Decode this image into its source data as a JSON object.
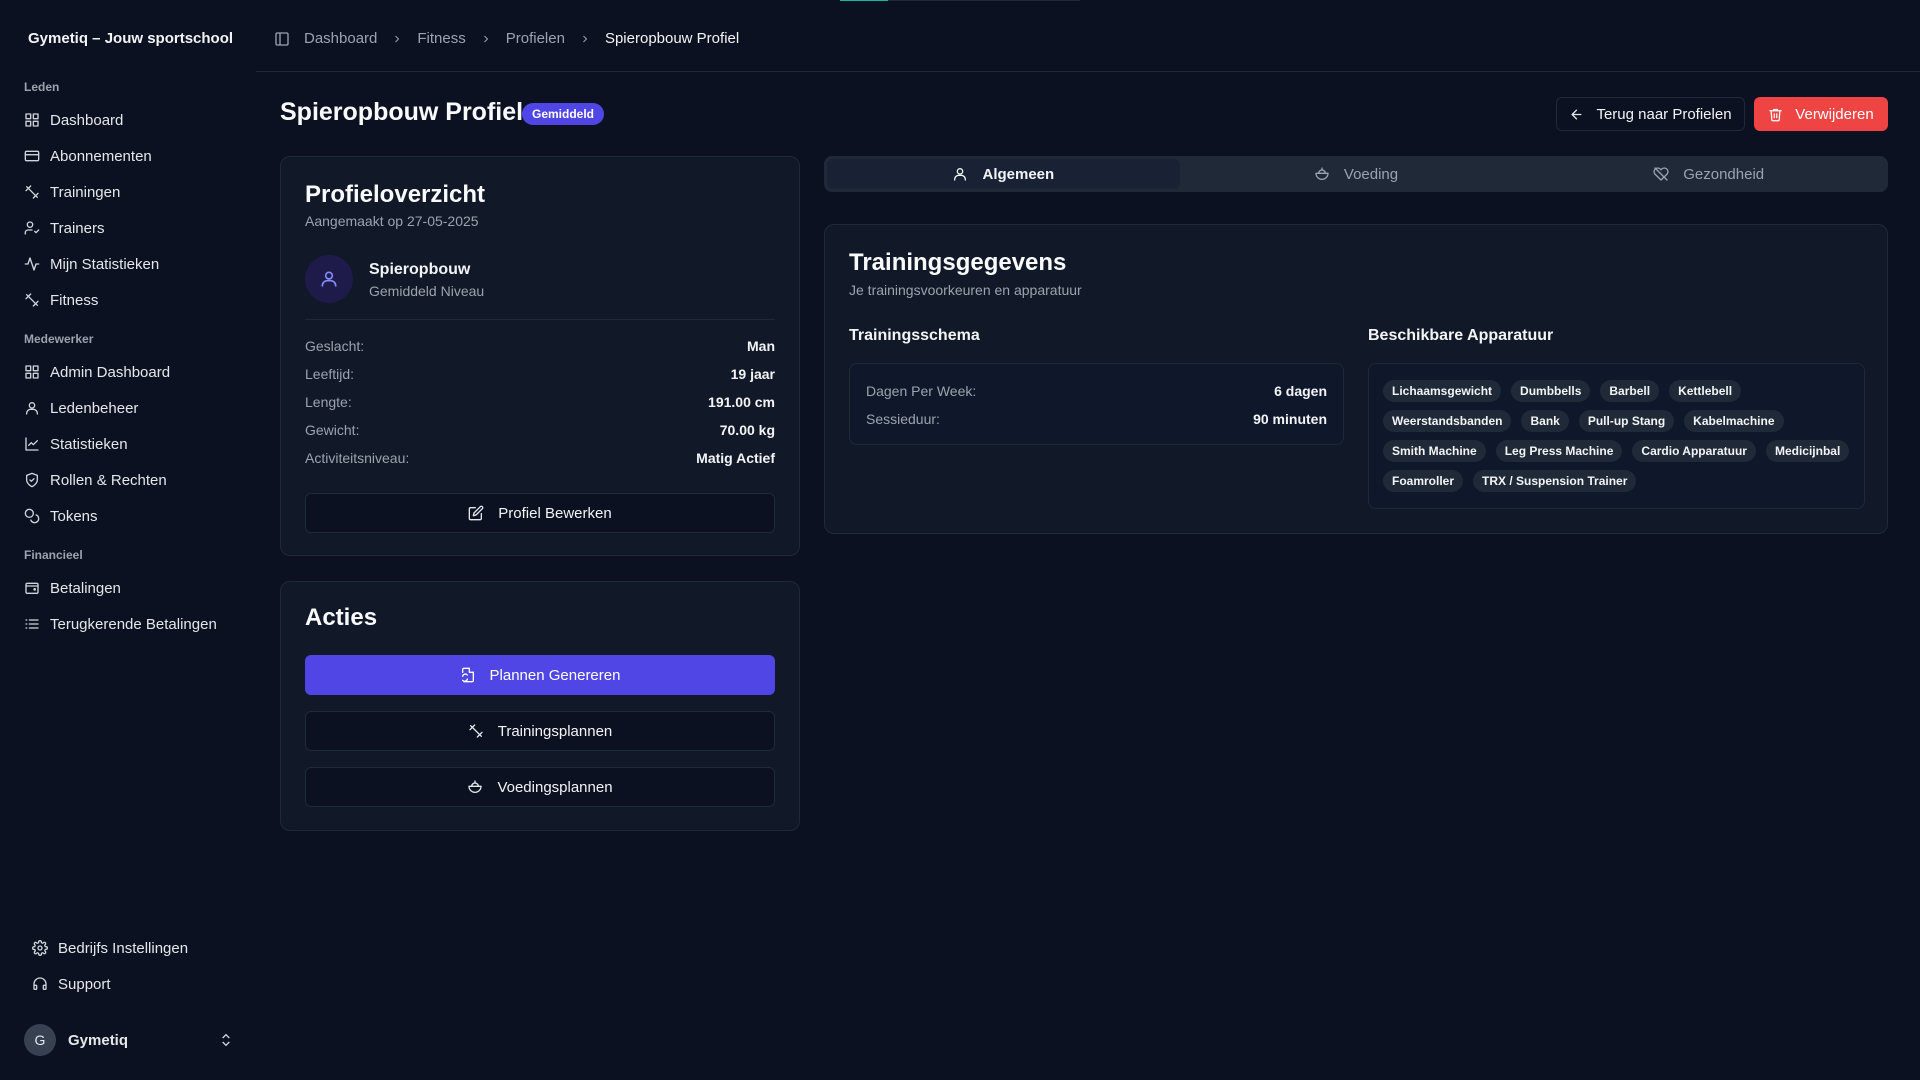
{
  "sidebar": {
    "brand": "Gymetiq – Jouw sportschool",
    "groups": [
      {
        "label": "Leden",
        "items": [
          "Dashboard",
          "Abonnementen",
          "Trainingen",
          "Trainers",
          "Mijn Statistieken",
          "Fitness"
        ]
      },
      {
        "label": "Medewerker",
        "items": [
          "Admin Dashboard",
          "Ledenbeheer",
          "Statistieken",
          "Rollen & Rechten",
          "Tokens"
        ]
      },
      {
        "label": "Financieel",
        "items": [
          "Betalingen",
          "Terugkerende Betalingen"
        ]
      }
    ],
    "footer": [
      "Bedrijfs Instellingen",
      "Support"
    ],
    "user": {
      "initial": "G",
      "name": "Gymetiq"
    }
  },
  "breadcrumb": [
    "Dashboard",
    "Fitness",
    "Profielen",
    "Spieropbouw Profiel"
  ],
  "page": {
    "title": "Spieropbouw Profiel",
    "badge": "Gemiddeld",
    "back_button": "Terug naar Profielen",
    "delete_button": "Verwijderen"
  },
  "overview": {
    "title": "Profieloverzicht",
    "created": "Aangemaakt op 27-05-2025",
    "profile_name": "Spieropbouw",
    "profile_level": "Gemiddeld Niveau",
    "rows": [
      {
        "k": "Geslacht:",
        "v": "Man"
      },
      {
        "k": "Leeftijd:",
        "v": "19 jaar"
      },
      {
        "k": "Lengte:",
        "v": "191.00 cm"
      },
      {
        "k": "Gewicht:",
        "v": "70.00 kg"
      },
      {
        "k": "Activiteitsniveau:",
        "v": "Matig Actief"
      }
    ],
    "edit_button": "Profiel Bewerken"
  },
  "actions": {
    "title": "Acties",
    "generate": "Plannen Genereren",
    "training_plans": "Trainingsplannen",
    "nutrition_plans": "Voedingsplannen"
  },
  "tabs": [
    "Algemeen",
    "Voeding",
    "Gezondheid"
  ],
  "training": {
    "title": "Trainingsgegevens",
    "subtitle": "Je trainingsvoorkeuren en apparatuur",
    "schedule_title": "Trainingsschema",
    "schedule": [
      {
        "k": "Dagen Per Week:",
        "v": "6 dagen"
      },
      {
        "k": "Sessieduur:",
        "v": "90 minuten"
      }
    ],
    "equipment_title": "Beschikbare Apparatuur",
    "equipment": [
      "Lichaamsgewicht",
      "Dumbbells",
      "Barbell",
      "Kettlebell",
      "Weerstandsbanden",
      "Bank",
      "Pull-up Stang",
      "Kabelmachine",
      "Smith Machine",
      "Leg Press Machine",
      "Cardio Apparatuur",
      "Medicijnbal",
      "Foamroller",
      "TRX / Suspension Trainer"
    ]
  },
  "colors": {
    "accent": "#4f46e5",
    "danger": "#ef4444",
    "background": "#0b1120",
    "card": "#111827"
  }
}
